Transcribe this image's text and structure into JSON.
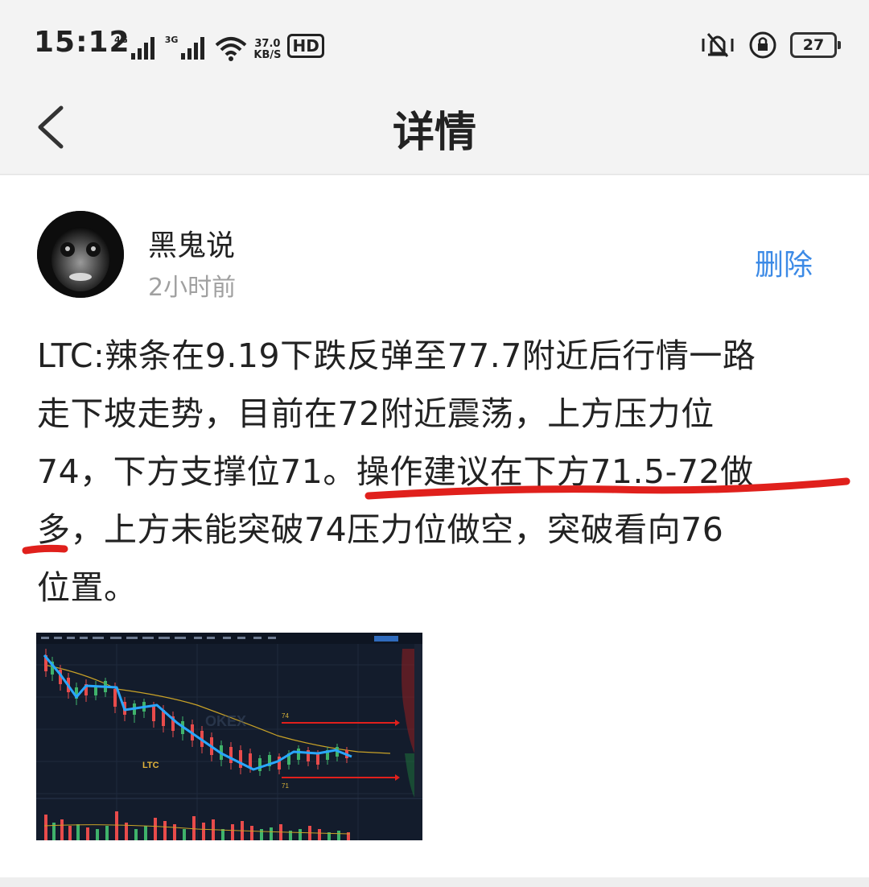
{
  "status_bar": {
    "time": "15:12",
    "signal_1_label": "4G",
    "signal_2_label": "3G",
    "net_speed_value": "37.0",
    "net_speed_unit": "KB/S",
    "hd_label": "HD",
    "battery_level": "27"
  },
  "header": {
    "title": "详情"
  },
  "post": {
    "author": "黑鬼说",
    "time": "2小时前",
    "delete_label": "删除",
    "body_lines": [
      "LTC:辣条在9.19下跌反弹至77.7附近后行情一路",
      "走下坡走势，目前在72附近震荡，上方压力位",
      "74，下方支撑位71。操作建议在下方71.5-72做",
      "多，上方未能突破74压力位做空，突破看向76",
      "位置。"
    ],
    "chart": {
      "symbol_label": "LTC",
      "resistance_label": "74",
      "support_label": "71",
      "watermark": "OKEX"
    }
  },
  "colors": {
    "accent_blue": "#3c8ae6",
    "annotation_red": "#e0201c",
    "chart_bg": "#131c2c"
  }
}
